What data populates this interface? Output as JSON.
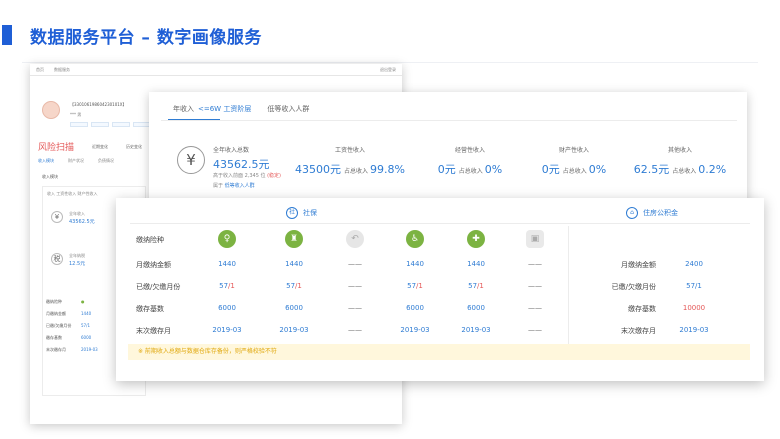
{
  "title": "数据服务平台 – 数字画像服务",
  "back_panel": {
    "top_left": "首页",
    "top_tab": "数据服务",
    "top_right": "退出登录",
    "id_text": "【330106198604230101X】",
    "name_text": "***  男",
    "risk_title": "风险扫描",
    "risk_sub1": "近期变化",
    "risk_sub2": "历史变化",
    "tabs": [
      "收入模块",
      "财产状况",
      "负债情况"
    ],
    "sub_title": "收入模块",
    "box_head": "收入   工资性收入   财产性收入",
    "item1_label": "全年收入",
    "item1_value": "43562.5元",
    "item2_label": "全年纳税",
    "item2_value": "12.5元",
    "mini_rows": [
      {
        "label": "缴纳险种",
        "value": "●"
      },
      {
        "label": "月缴纳金额",
        "value": "1440"
      },
      {
        "label": "已缴/欠缴月份",
        "value": "57/1"
      },
      {
        "label": "缴存基数",
        "value": "6000"
      },
      {
        "label": "末次缴存月",
        "value": "2019-03"
      }
    ]
  },
  "income": {
    "tab0": "年收入",
    "tab1": "<=6W 工资阶层",
    "tab2": "低等收入人群",
    "total_label": "全年收入总数",
    "total_value": "43562.5元",
    "rank_text": "高于收入前面 2,345 位",
    "rank_flag": "(稳定)",
    "group_prefix": "属于",
    "group_link": "低等收入人群",
    "share_label": "占总收入",
    "items": [
      {
        "label": "工资性收入",
        "value": "43500元",
        "pct": "99.8%"
      },
      {
        "label": "经营性收入",
        "value": "0元",
        "pct": "0%"
      },
      {
        "label": "财产性收入",
        "value": "0元",
        "pct": "0%"
      },
      {
        "label": "其他收入",
        "value": "62.5元",
        "pct": "0.2%"
      }
    ]
  },
  "social": {
    "title": "社保",
    "row_labels": [
      "缴纳险种",
      "月缴纳金额",
      "已缴/欠缴月份",
      "缴存基数",
      "末次缴存月"
    ],
    "icons": [
      {
        "name": "pension-icon",
        "glyph": "♀",
        "active": true
      },
      {
        "name": "medical-icon",
        "glyph": "♜",
        "active": true
      },
      {
        "name": "unemployment-icon",
        "glyph": "↶",
        "active": false
      },
      {
        "name": "injury-icon",
        "glyph": "♿",
        "active": true
      },
      {
        "name": "maternity-icon",
        "glyph": "✚",
        "active": true
      },
      {
        "name": "other-icon",
        "glyph": "▣",
        "active": false
      }
    ],
    "amount": [
      "1440",
      "1440",
      "——",
      "1440",
      "1440",
      "——"
    ],
    "paid": [
      "57",
      "57",
      "——",
      "57",
      "57",
      "——"
    ],
    "owed": [
      "/1",
      "/1",
      "",
      "/1",
      "/1",
      ""
    ],
    "base": [
      "6000",
      "6000",
      "——",
      "6000",
      "6000",
      "——"
    ],
    "last": [
      "2019-03",
      "2019-03",
      "——",
      "2019-03",
      "2019-03",
      "——"
    ]
  },
  "fund": {
    "title": "住房公积金",
    "rows": [
      {
        "label": "月缴纳金额",
        "value": "2400"
      },
      {
        "label": "已缴/欠缴月份",
        "value": "57/1"
      },
      {
        "label": "缴存基数",
        "value": "10000"
      },
      {
        "label": "末次缴存月",
        "value": "2019-03"
      }
    ]
  },
  "note": "※ 前期收入总额与数据仓库存备份，则严格校验不符"
}
